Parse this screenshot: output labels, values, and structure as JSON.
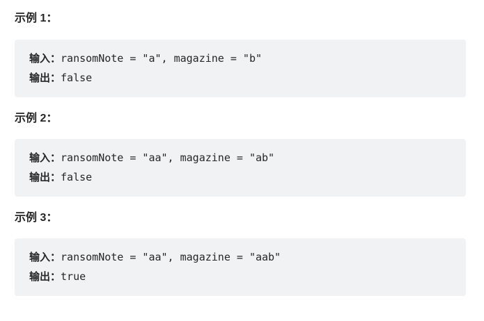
{
  "examples": [
    {
      "heading": "示例 1：",
      "input_label": "输入：",
      "input_value": "ransomNote = \"a\", magazine = \"b\"",
      "output_label": "输出：",
      "output_value": "false"
    },
    {
      "heading": "示例 2：",
      "input_label": "输入：",
      "input_value": "ransomNote = \"aa\", magazine = \"ab\"",
      "output_label": "输出：",
      "output_value": "false"
    },
    {
      "heading": "示例 3：",
      "input_label": "输入：",
      "input_value": "ransomNote = \"aa\", magazine = \"aab\"",
      "output_label": "输出：",
      "output_value": "true"
    }
  ]
}
